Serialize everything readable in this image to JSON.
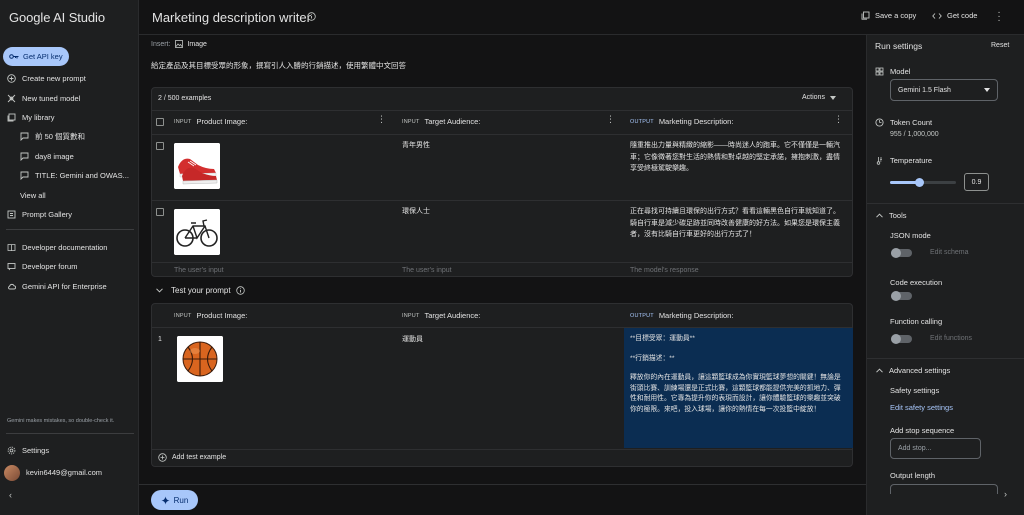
{
  "sidebar": {
    "logo": "Google AI Studio",
    "api_key": "Get API key",
    "items": [
      {
        "label": "Create new prompt"
      },
      {
        "label": "New tuned model"
      },
      {
        "label": "My library"
      }
    ],
    "library": [
      {
        "label": "前 50 個質數和"
      },
      {
        "label": "day8 image"
      },
      {
        "label": "TITLE: Gemini and OWAS..."
      }
    ],
    "view_all": "View all",
    "prompt_gallery": "Prompt Gallery",
    "links": [
      {
        "label": "Developer documentation"
      },
      {
        "label": "Developer forum"
      },
      {
        "label": "Gemini API for Enterprise"
      }
    ],
    "disclaimer": "Gemini makes mistakes, so double-check it.",
    "settings": "Settings",
    "user": "kevin6449@gmail.com",
    "collapse": "‹"
  },
  "topbar": {
    "title": "Marketing description writer",
    "save_copy": "Save a copy",
    "get_code": "Get code"
  },
  "main": {
    "insert_label": "Insert:",
    "insert_image": "Image",
    "system_instructions": "給定產品及其目標受眾的形象，撰寫引人入勝的行銷描述，使用繁體中文回答",
    "examples": {
      "count": "2 / 500 examples",
      "actions": "Actions",
      "columns": [
        {
          "tag": "INPUT",
          "label": "Product Image:"
        },
        {
          "tag": "INPUT",
          "label": "Target Audience:"
        },
        {
          "tag": "OUTPUT",
          "label": "Marketing Description:"
        }
      ],
      "rows": [
        {
          "image": "red-sneakers",
          "audience": "青年男性",
          "description": "隨重推出力量與精緻的縮影——時尚迷人的跑車。它不僅僅是一輛汽車；它像徵著您對生活的熱情和對卓越的堅定承諾，擁抱刺激，盡情享受終極駕駛樂趣。"
        },
        {
          "image": "bicycle",
          "audience": "環保人士",
          "description": "正在尋找可持續且環保的出行方式？看看這輛黑色自行車就知道了。騎自行車是減少碳足跡並同時改善健康的好方法。如果您是環保主義者，沒有比騎自行車更好的出行方式了！"
        }
      ],
      "placeholders": [
        "The user's input",
        "The user's input",
        "The model's response"
      ]
    },
    "test": {
      "title": "Test your prompt",
      "columns": [
        {
          "tag": "INPUT",
          "label": "Product Image:"
        },
        {
          "tag": "INPUT",
          "label": "Target Audience:"
        },
        {
          "tag": "OUTPUT",
          "label": "Marketing Description:"
        }
      ],
      "row_number": "1",
      "image": "basketball",
      "audience": "運動員",
      "output_line1": "**目標受眾：運動員**",
      "output_line2": "**行銷描述：**",
      "output_body": "釋放你的內在運動員，讓這顆籃球成為你實現籃球夢想的關鍵！無論是街頭比賽、訓練場還是正式比賽，這顆籃球都能提供完美的抓地力、彈性和耐用性。它專為提升你的表現而設計，讓你體驗籃球的樂趣並突破你的極限。來吧，投入球場，讓你的熱情在每一次投籃中綻放！",
      "add_example": "Add test example"
    },
    "run": "Run"
  },
  "run_settings": {
    "title": "Run settings",
    "reset": "Reset",
    "model_label": "Model",
    "model_value": "Gemini 1.5 Flash",
    "token_label": "Token Count",
    "token_value": "955 / 1,000,000",
    "temperature_label": "Temperature",
    "temperature_value": "0.9",
    "temperature_fraction": 0.45,
    "tools": "Tools",
    "json_mode": "JSON mode",
    "edit_schema": "Edit schema",
    "code_execution": "Code execution",
    "function_calling": "Function calling",
    "edit_functions": "Edit functions",
    "advanced": "Advanced settings",
    "safety": "Safety settings",
    "edit_safety": "Edit safety settings",
    "stop_label": "Add stop sequence",
    "stop_placeholder": "Add stop...",
    "output_length": "Output length",
    "expand": "›"
  },
  "colors": {
    "accent": "#a8c7fa",
    "output_bg": "#0b2d52",
    "link": "#a8c7fa"
  }
}
